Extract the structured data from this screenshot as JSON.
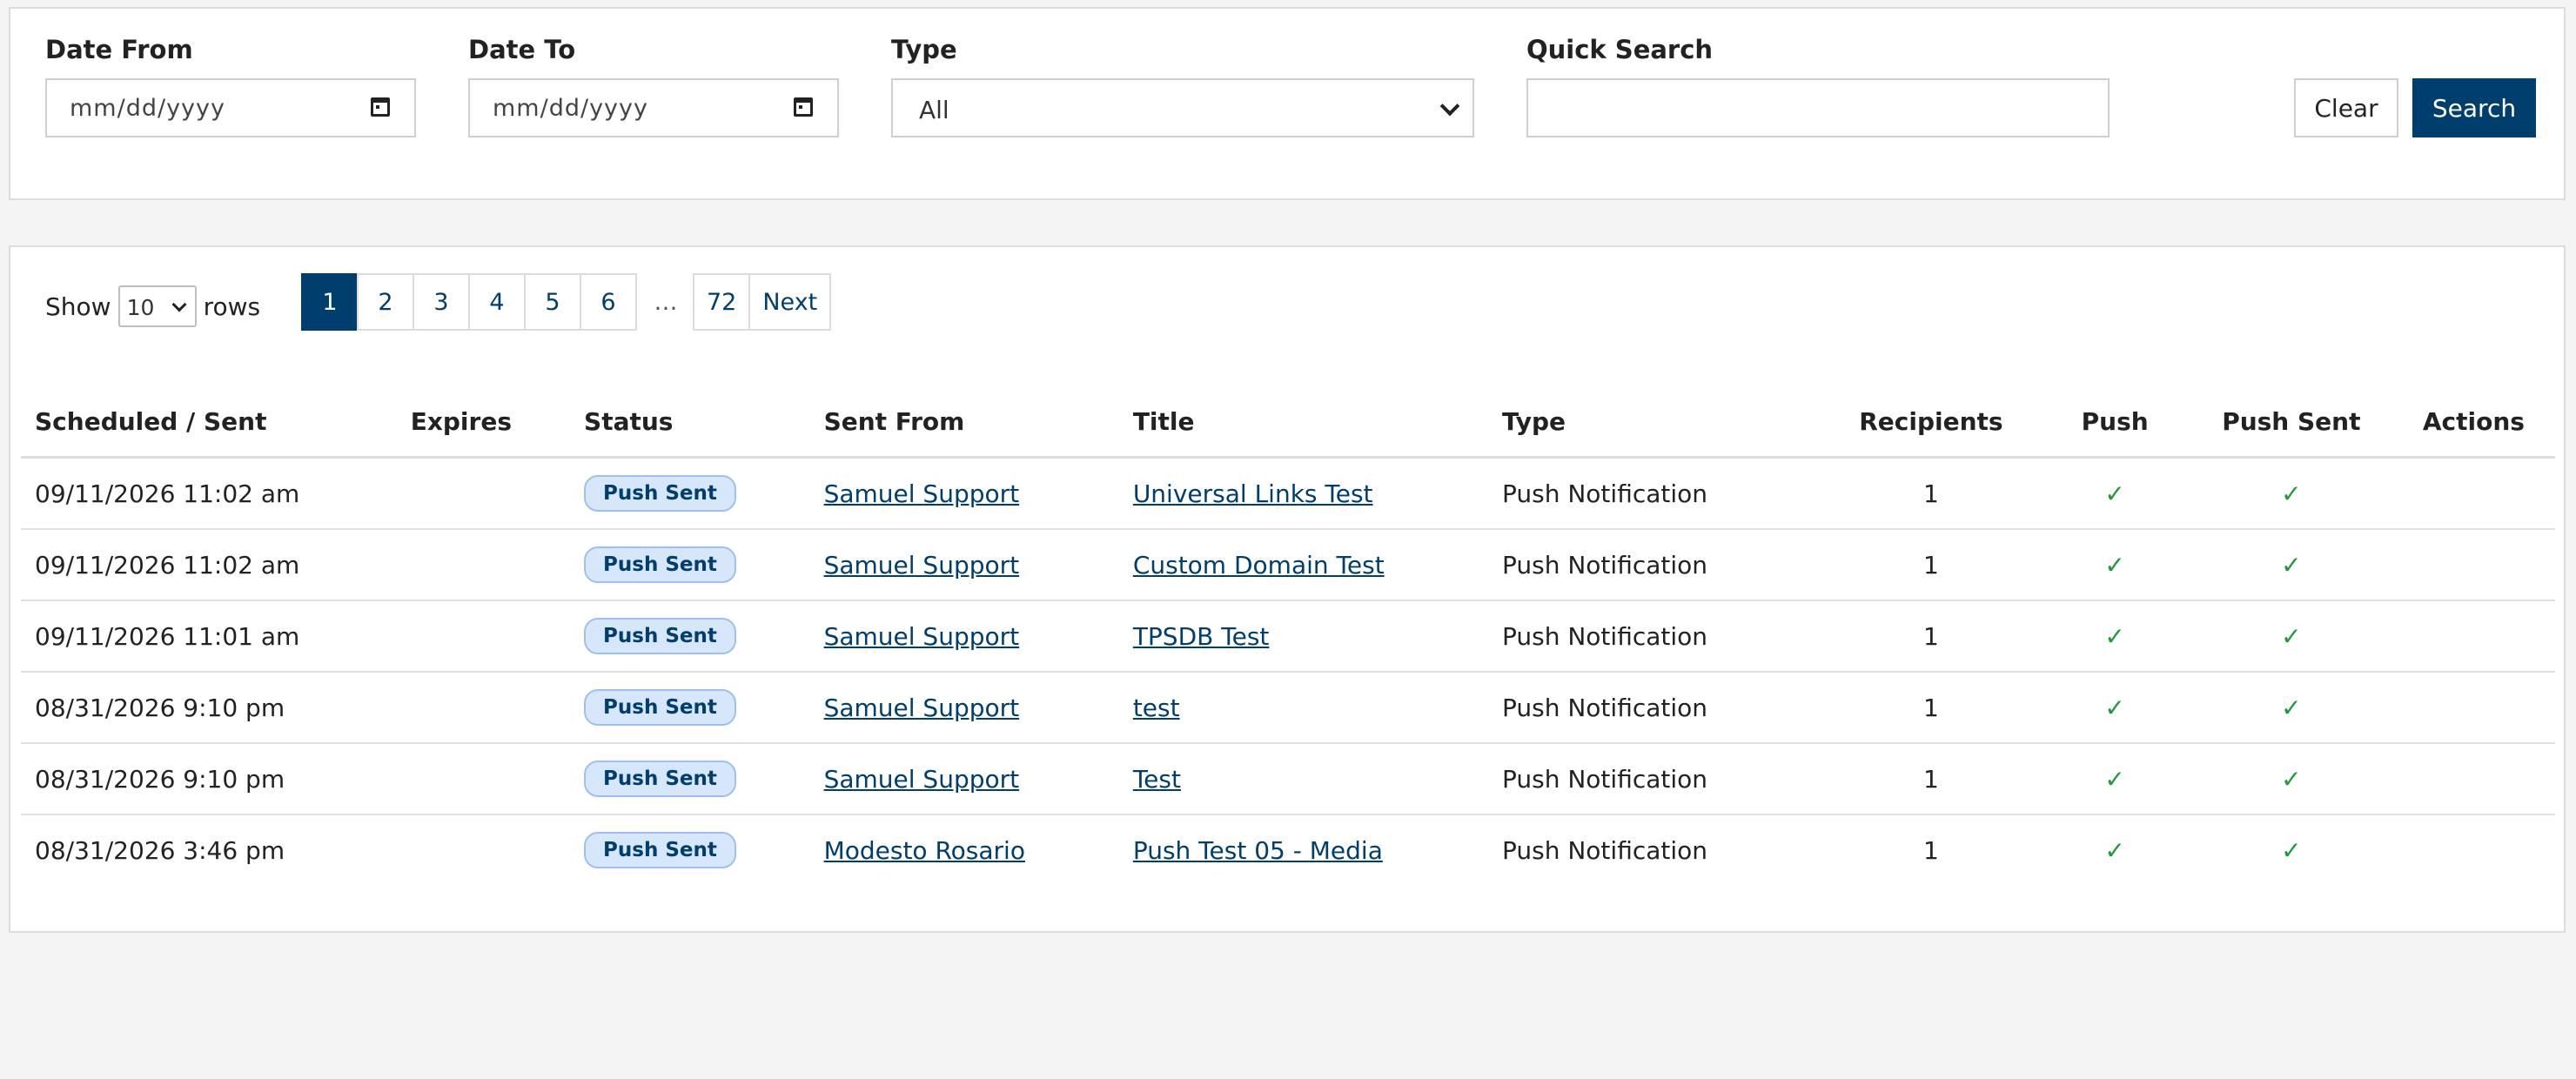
{
  "filters": {
    "date_from_label": "Date From",
    "date_from_placeholder": "mm/dd/yyyy",
    "date_to_label": "Date To",
    "date_to_placeholder": "mm/dd/yyyy",
    "type_label": "Type",
    "type_value": "All",
    "quick_search_label": "Quick Search",
    "quick_search_value": "",
    "clear_label": "Clear",
    "search_label": "Search"
  },
  "table_controls": {
    "show_label": "Show",
    "rows_value": "10",
    "rows_label": "rows",
    "pages": [
      "1",
      "2",
      "3",
      "4",
      "5",
      "6"
    ],
    "ellipsis": "…",
    "last_page": "72",
    "next_label": "Next",
    "active_page": "1"
  },
  "columns": [
    "Scheduled / Sent",
    "Expires",
    "Status",
    "Sent From",
    "Title",
    "Type",
    "Recipients",
    "Push",
    "Push Sent",
    "Actions"
  ],
  "rows": [
    {
      "scheduled": "09/11/2026 11:02 am",
      "expires": "",
      "status": "Push Sent",
      "sent_from": "Samuel Support",
      "title": "Universal Links Test",
      "type": "Push Notification",
      "recipients": "1",
      "push": "✓",
      "push_sent": "✓"
    },
    {
      "scheduled": "09/11/2026 11:02 am",
      "expires": "",
      "status": "Push Sent",
      "sent_from": "Samuel Support",
      "title": "Custom Domain Test",
      "type": "Push Notification",
      "recipients": "1",
      "push": "✓",
      "push_sent": "✓"
    },
    {
      "scheduled": "09/11/2026 11:01 am",
      "expires": "",
      "status": "Push Sent",
      "sent_from": "Samuel Support",
      "title": "TPSDB Test",
      "type": "Push Notification",
      "recipients": "1",
      "push": "✓",
      "push_sent": "✓"
    },
    {
      "scheduled": "08/31/2026 9:10 pm",
      "expires": "",
      "status": "Push Sent",
      "sent_from": "Samuel Support",
      "title": "test",
      "type": "Push Notification",
      "recipients": "1",
      "push": "✓",
      "push_sent": "✓"
    },
    {
      "scheduled": "08/31/2026 9:10 pm",
      "expires": "",
      "status": "Push Sent",
      "sent_from": "Samuel Support",
      "title": "Test",
      "type": "Push Notification",
      "recipients": "1",
      "push": "✓",
      "push_sent": "✓"
    },
    {
      "scheduled": "08/31/2026 3:46 pm",
      "expires": "",
      "status": "Push Sent",
      "sent_from": "Modesto Rosario",
      "title": "Push Test 05 - Media",
      "type": "Push Notification",
      "recipients": "1",
      "push": "✓",
      "push_sent": "✓"
    }
  ],
  "colors": {
    "primary": "#003e6e",
    "badge_bg": "#d7e7fb",
    "check": "#1f9a3a",
    "page_bg": "#f4f4f4"
  }
}
